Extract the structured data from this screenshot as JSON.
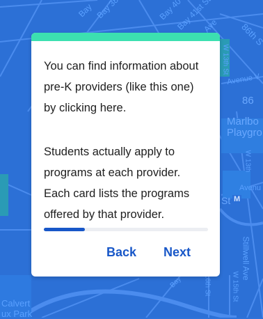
{
  "map": {
    "labels": {
      "bay_1": "Bay",
      "bay_2": "Bay 38",
      "bay_3": "Bay 40",
      "bay_41": "Bay 41st St",
      "ave": "Ave",
      "st_86": "86th S",
      "w13": "W 13th St",
      "avenue_v": "Avenue V",
      "num_86": "86",
      "marlboro": "Marlbo",
      "playground": "Playgro",
      "w13b": "W 13th",
      "avenu": "Avenu",
      "st_m": "St",
      "m_badge": "M",
      "stillwell": "Stillwell Ave",
      "w15": "W 15th St",
      "th16": "16th St",
      "bay_bottom": "Bay",
      "calvert": "Calvert",
      "vaux_park": "ux Park"
    }
  },
  "tooltip": {
    "message_1": "You can find information about pre-K providers (like this one) by clicking here.",
    "message_2": "Students actually apply to programs at each provider. Each card lists the programs offered by that provider.",
    "progress": 0.25,
    "back_label": "Back",
    "next_label": "Next"
  },
  "colors": {
    "accent": "#3ce0b0",
    "primary": "#1857c8",
    "map_bg": "#2c70d6"
  }
}
